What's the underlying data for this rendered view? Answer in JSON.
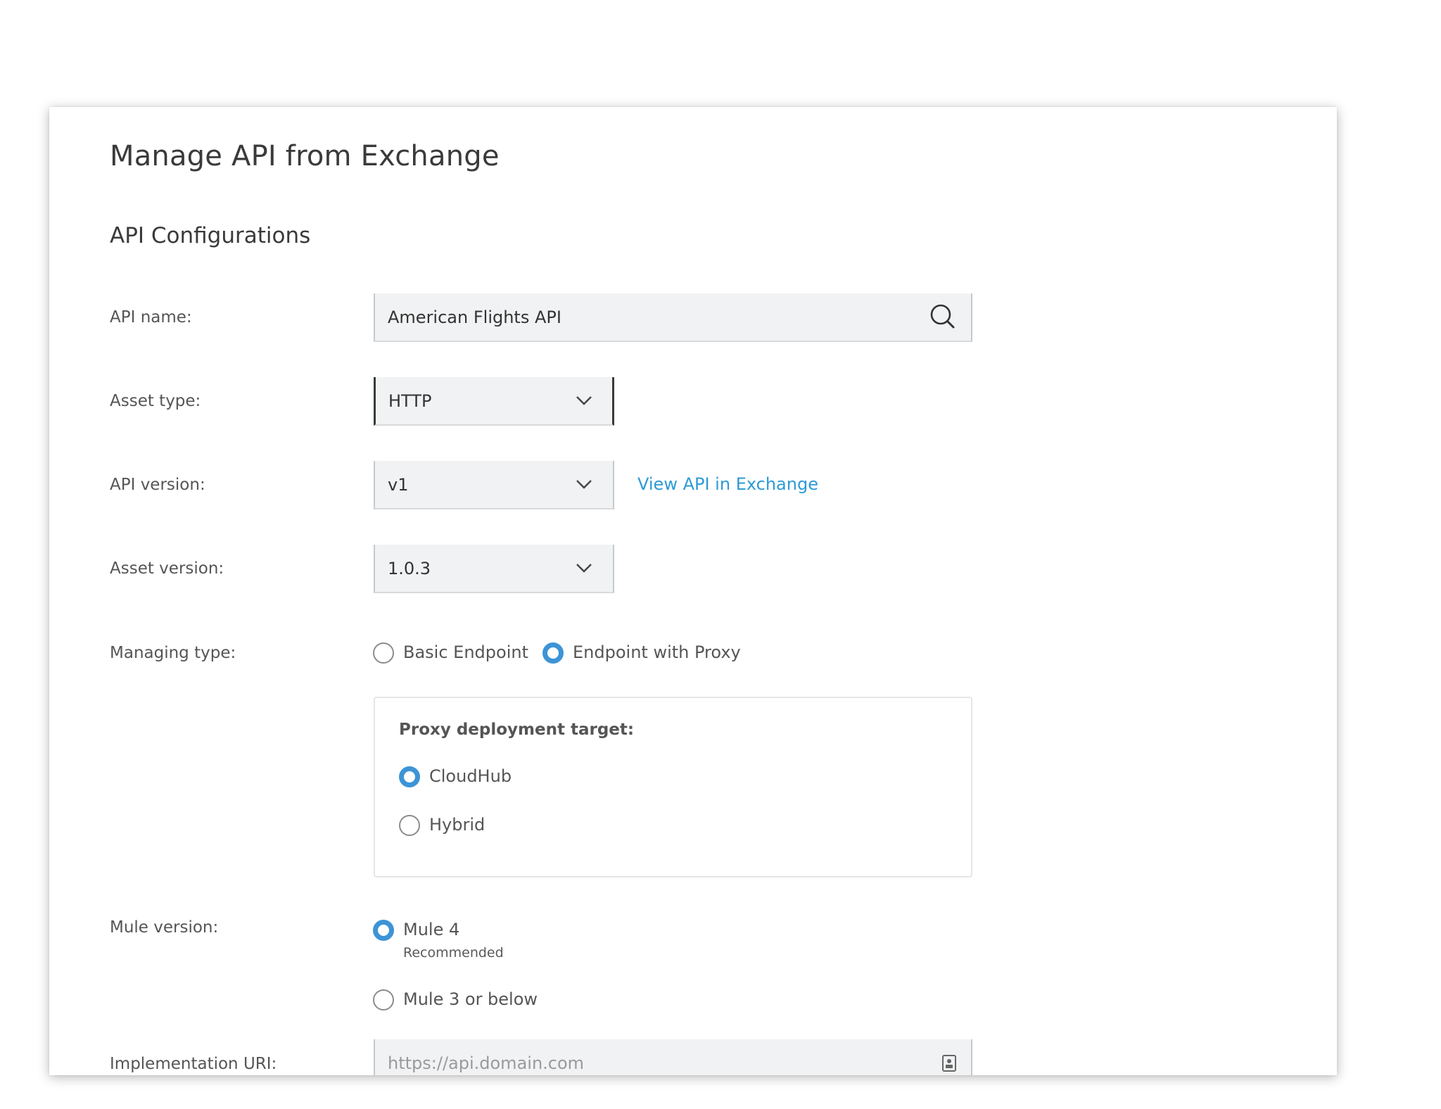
{
  "dialog": {
    "title": "Manage API from Exchange",
    "section_title": "API Configurations"
  },
  "fields": {
    "api_name": {
      "label": "API name:",
      "value": "American Flights API",
      "icon": "search-icon"
    },
    "asset_type": {
      "label": "Asset type:",
      "value": "HTTP",
      "icon": "chevron-down-icon"
    },
    "api_version": {
      "label": "API version:",
      "value": "v1",
      "icon": "chevron-down-icon",
      "link": "View API in Exchange"
    },
    "asset_version": {
      "label": "Asset version:",
      "value": "1.0.3",
      "icon": "chevron-down-icon"
    },
    "managing_type": {
      "label": "Managing type:",
      "options": [
        {
          "label": "Basic Endpoint",
          "checked": false
        },
        {
          "label": "Endpoint with Proxy",
          "checked": true
        }
      ]
    },
    "proxy_target": {
      "title": "Proxy deployment target:",
      "options": [
        {
          "label": "CloudHub",
          "checked": true
        },
        {
          "label": "Hybrid",
          "checked": false
        }
      ]
    },
    "mule_version": {
      "label": "Mule version:",
      "options": [
        {
          "label": "Mule 4",
          "sublabel": "Recommended",
          "checked": true
        },
        {
          "label": "Mule 3 or below",
          "checked": false
        }
      ]
    },
    "implementation_uri": {
      "label": "Implementation URI:",
      "placeholder": "https://api.domain.com",
      "icon": "contact-card-icon"
    }
  },
  "colors": {
    "accent": "#3d94d6",
    "link": "#2d9ad6",
    "input_bg": "#f1f2f3"
  }
}
